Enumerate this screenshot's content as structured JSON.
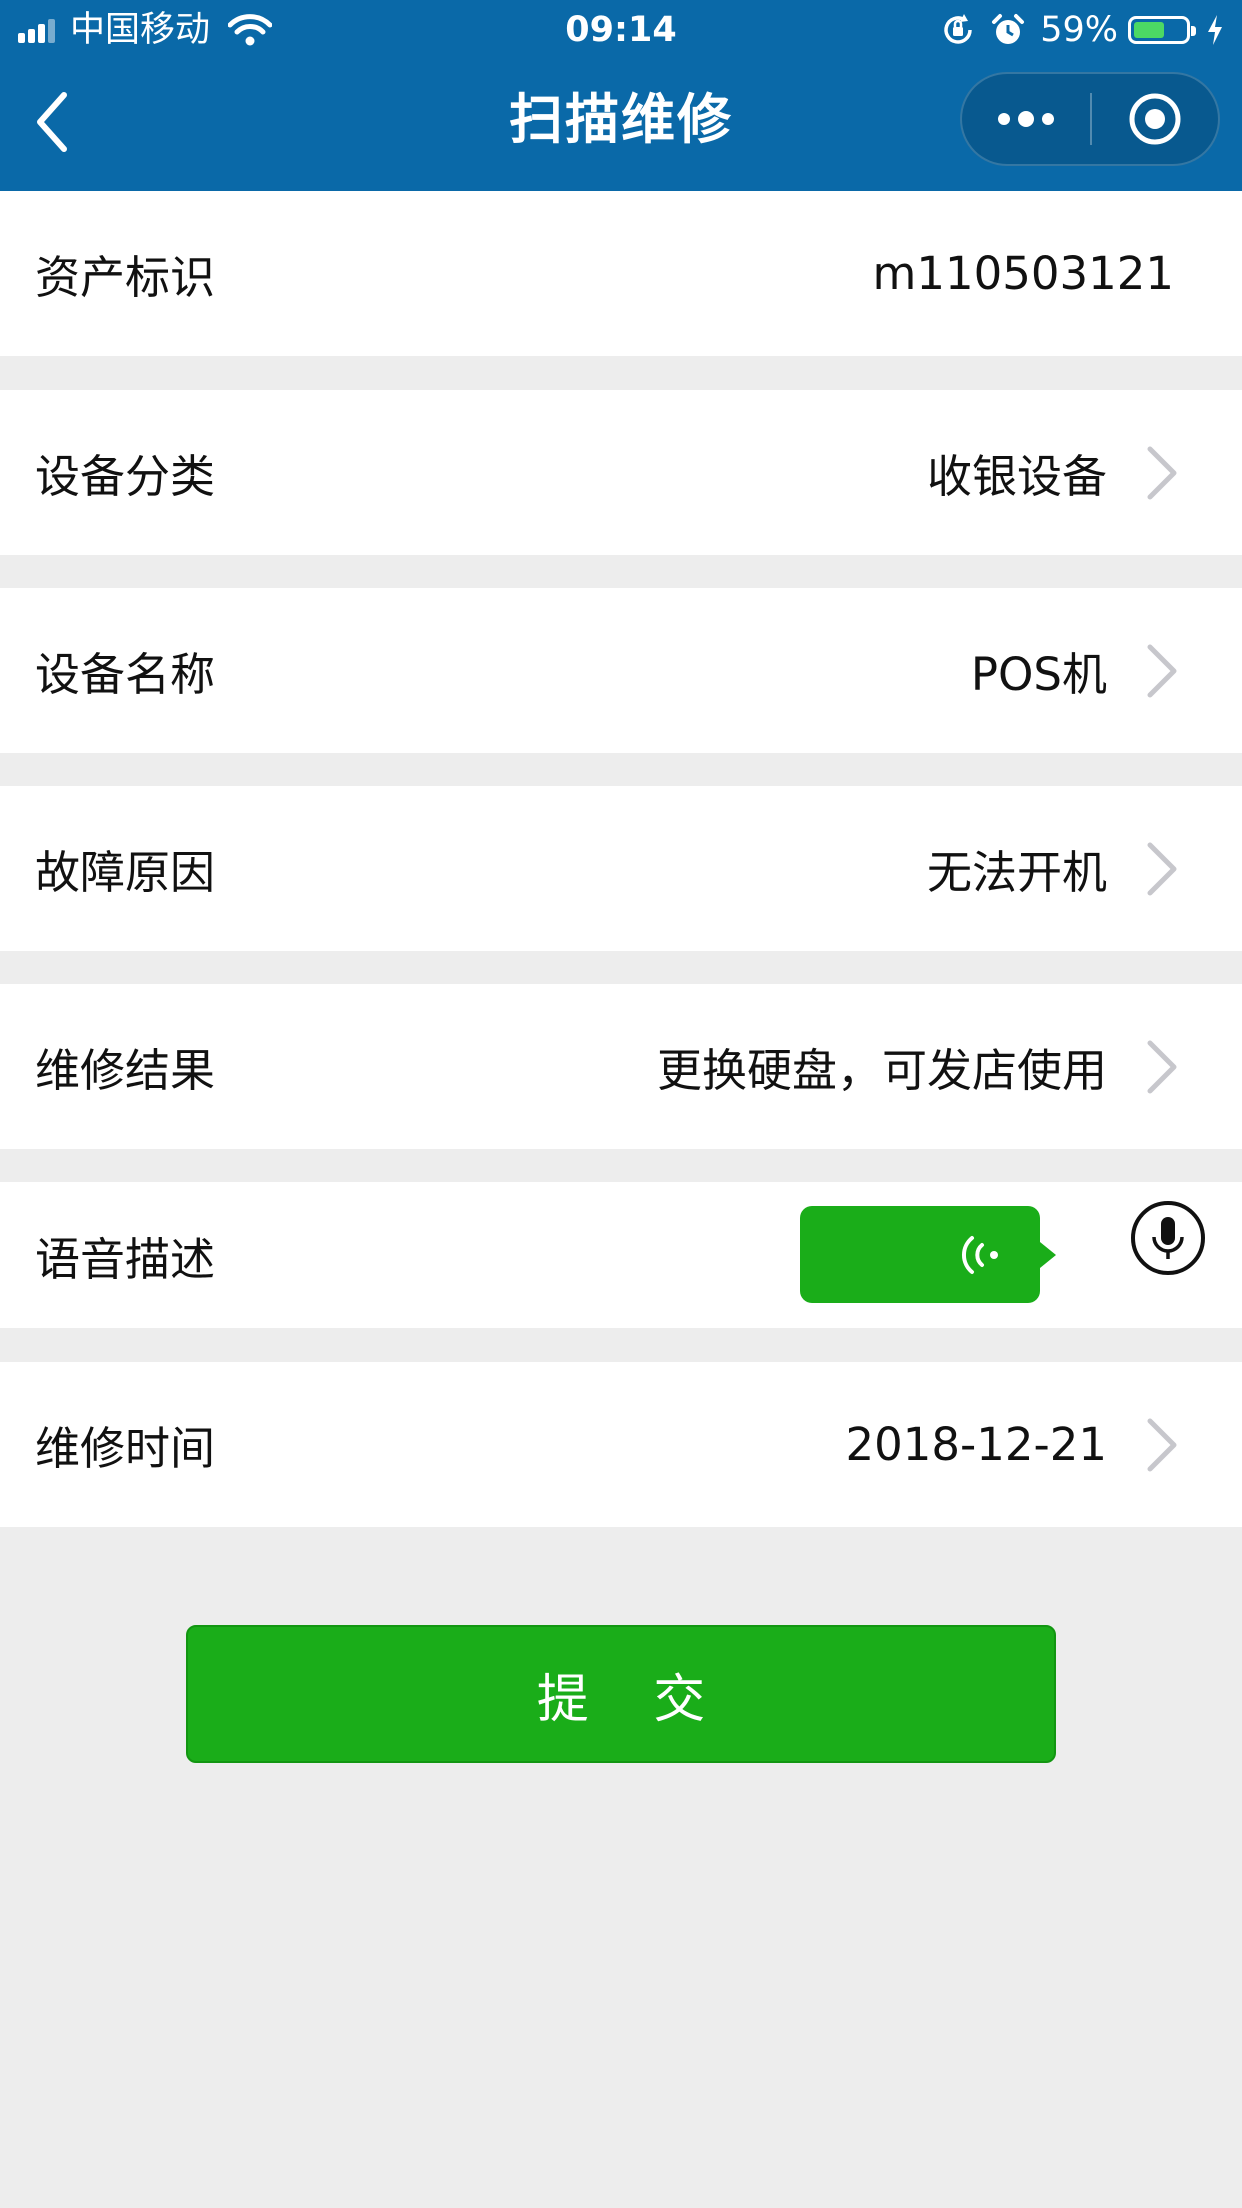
{
  "status_bar": {
    "carrier": "中国移动",
    "time": "09:14",
    "battery_percent": "59%",
    "battery_level": 0.59,
    "icons": [
      "signal-icon",
      "wifi-icon",
      "rotation-lock-icon",
      "alarm-icon",
      "battery-icon",
      "charging-icon"
    ]
  },
  "navbar": {
    "title": "扫描维修",
    "back_icon": "chevron-left-icon",
    "capsule_icons": [
      "more-icon",
      "close-target-icon"
    ]
  },
  "form": {
    "asset_id": {
      "label": "资产标识",
      "value": "m110503121"
    },
    "category": {
      "label": "设备分类",
      "value": "收银设备"
    },
    "name": {
      "label": "设备名称",
      "value": "POS机"
    },
    "fault": {
      "label": "故障原因",
      "value": "无法开机"
    },
    "result": {
      "label": "维修结果",
      "value": "更换硬盘，可发店使用"
    },
    "voice": {
      "label": "语音描述"
    },
    "date": {
      "label": "维修时间",
      "value": "2018-12-21"
    }
  },
  "submit_label": "提 交",
  "colors": {
    "header": "#0a69a8",
    "primary_green": "#1aad19",
    "page_bg": "#ededed",
    "row_bg": "#ffffff"
  }
}
